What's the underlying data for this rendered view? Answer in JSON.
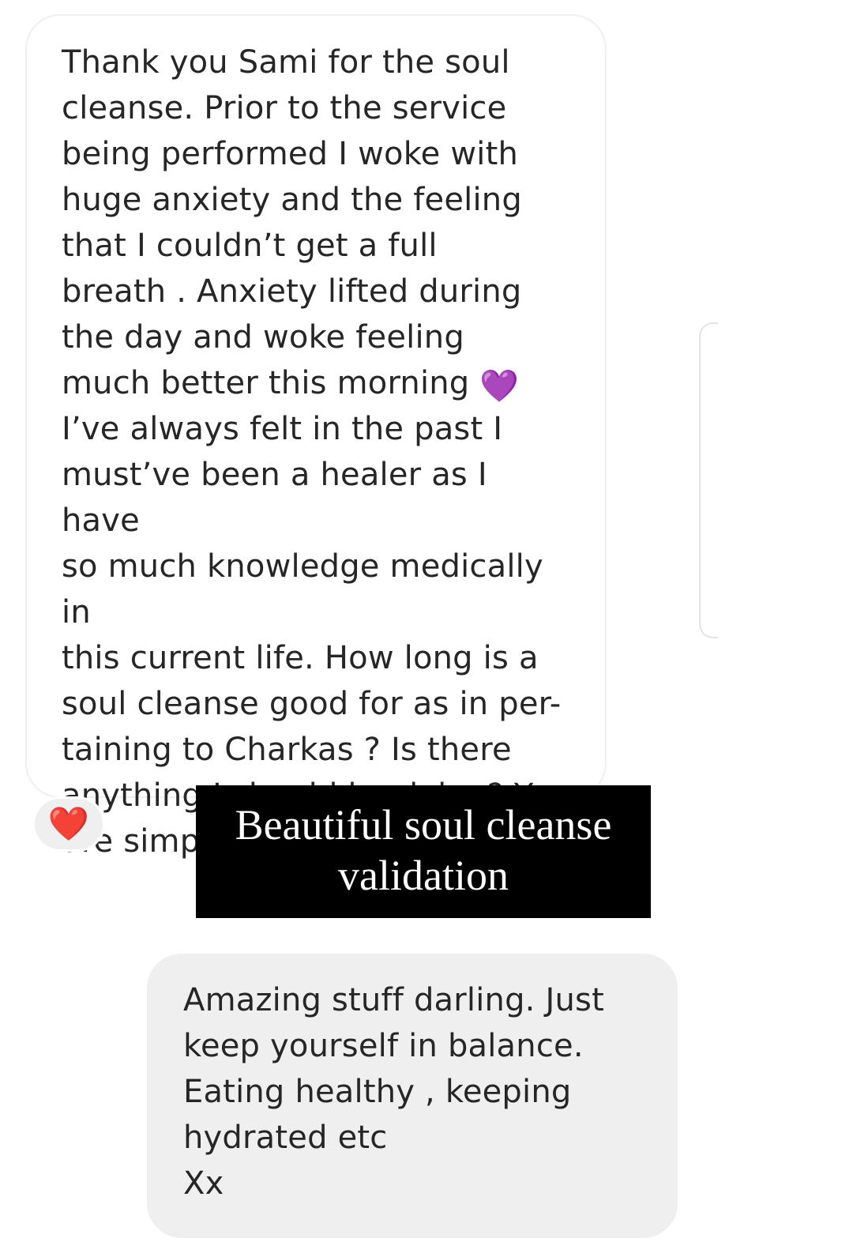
{
  "incoming_message": {
    "text": "Thank you Sami for the soul\ncleanse. Prior to the service\nbeing performed I woke with\nhuge anxiety and the feeling\nthat I couldn’t get a full\nbreath .  Anxiety lifted during\nthe day and woke feeling\nmuch better this morning",
    "heart_emoji": "💜",
    "text_continued": "I’ve always felt in the past I\nmust’ve been a healer as I have\nso much knowledge medically in\nthis current life. How long is a\nsoul cleanse good for as in per-\ntaining to Charkas ? Is there\nanything I should be doing? You\nare simply the best",
    "kiss_emojis": "😘😘😘"
  },
  "reaction": {
    "emoji": "❤️"
  },
  "caption": {
    "text": "Beautiful soul cleanse\nvalidation"
  },
  "outgoing_message": {
    "text": "Amazing stuff darling. Just\nkeep yourself in balance.\nEating healthy , keeping\nhydrated etc\n Xx"
  },
  "colors": {
    "incoming_bubble_bg": "#ffffff",
    "outgoing_bubble_bg": "#efefef",
    "caption_bg": "#000000",
    "caption_text": "#ffffff",
    "message_text": "#262626",
    "reaction_heart": "#ed1d24"
  }
}
